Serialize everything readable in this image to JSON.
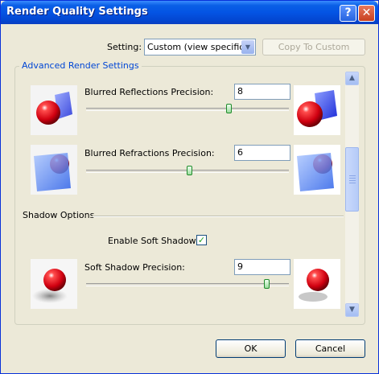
{
  "window": {
    "title": "Render Quality Settings",
    "help_label": "?",
    "close_label": "✕"
  },
  "setting": {
    "label": "Setting:",
    "value": "Custom (view specific)",
    "copy_button": "Copy To Custom"
  },
  "advanced": {
    "title": "Advanced Render Settings",
    "reflections": {
      "label": "Blurred Reflections Precision:",
      "value": "8",
      "slider_fraction": 0.71
    },
    "refractions": {
      "label": "Blurred Refractions Precision:",
      "value": "6",
      "slider_fraction": 0.51
    }
  },
  "shadow": {
    "section_label": "Shadow Options",
    "soft_shadows_label": "Enable Soft Shadows:",
    "soft_shadows_checked": true,
    "precision_label": "Soft Shadow Precision:",
    "precision_value": "9",
    "slider_fraction": 0.9
  },
  "footer": {
    "ok": "OK",
    "cancel": "Cancel"
  },
  "colors": {
    "title_bar": "#0454e4",
    "group_title": "#0046d5",
    "sphere": "#e0101a",
    "cube": "#2b3cf0"
  },
  "icons": {
    "help": "help-icon",
    "close": "close-icon",
    "scroll_up": "chevron-up-icon",
    "scroll_down": "chevron-down-icon",
    "dropdown": "chevron-down-icon"
  }
}
